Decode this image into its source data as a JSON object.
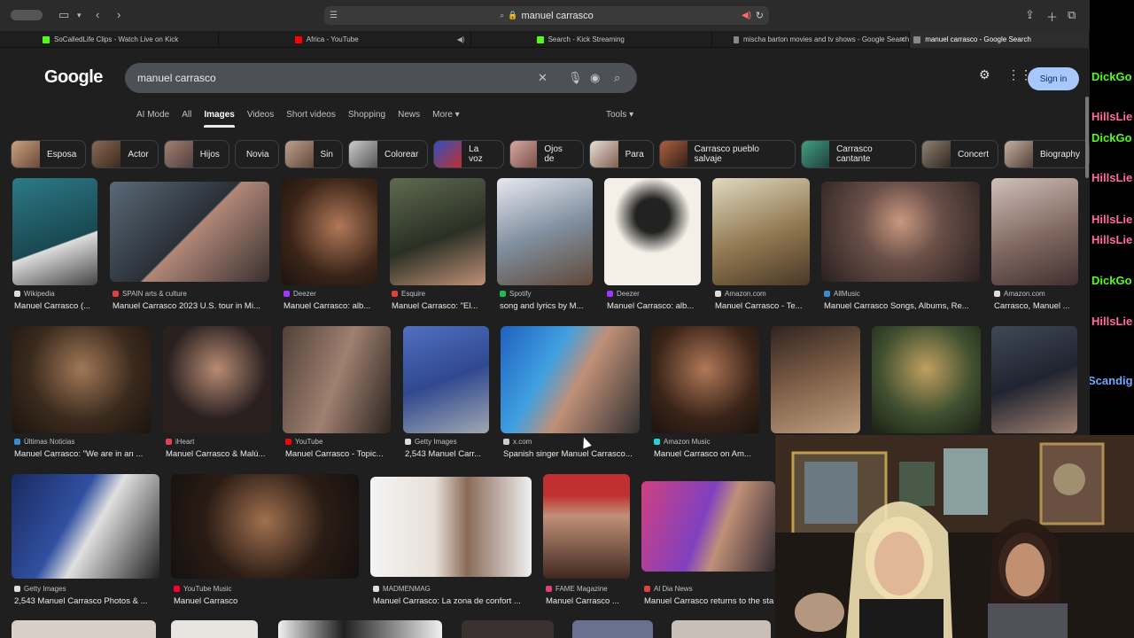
{
  "address": "manuel carrasco",
  "tabs": [
    {
      "title": "SoCalledLife Clips - Watch Live on Kick",
      "color": "#53fc18",
      "active": false
    },
    {
      "title": "Africa - YouTube",
      "color": "#ff0000",
      "active": false
    },
    {
      "title": "Search - Kick Streaming",
      "color": "#53fc18",
      "active": false
    },
    {
      "title": "mischa barton movies and tv shows - Google Search",
      "color": "#888888",
      "active": false
    },
    {
      "title": "manuel carrasco - Google Search",
      "color": "#888888",
      "active": true
    }
  ],
  "google": {
    "logo": "Google",
    "query": "manuel carrasco",
    "sign_in": "Sign in",
    "nav": [
      "AI Mode",
      "All",
      "Images",
      "Videos",
      "Short videos",
      "Shopping",
      "News",
      "More ▾"
    ],
    "tools": "Tools ▾",
    "chips": [
      "Esposa",
      "Actor",
      "Hijos",
      "Novia",
      "Sin",
      "Colorear",
      "La voz",
      "Ojos de",
      "Para",
      "Carrasco pueblo salvaje",
      "Carrasco cantante",
      "Concert",
      "Biography"
    ]
  },
  "results": {
    "row1": [
      {
        "source": "Wikipedia",
        "caption": "Manuel Carrasco (..."
      },
      {
        "source": "SPAIN arts & culture",
        "caption": "Manuel Carrasco 2023 U.S. tour in Mi..."
      },
      {
        "source": "Deezer",
        "caption": "Manuel Carrasco: alb..."
      },
      {
        "source": "Esquire",
        "caption": "Manuel Carrasco: \"El..."
      },
      {
        "source": "Spotify",
        "caption": "song and lyrics by M..."
      },
      {
        "source": "Deezer",
        "caption": "Manuel Carrasco: alb..."
      },
      {
        "source": "Amazon.com",
        "caption": "Manuel Carrasco - Te..."
      },
      {
        "source": "AllMusic",
        "caption": "Manuel Carrasco Songs, Albums, Re..."
      },
      {
        "source": "Amazon.com",
        "caption": "Carrasco, Manuel ..."
      }
    ],
    "row2": [
      {
        "source": "Últimas Noticias",
        "caption": "Manuel Carrasco: \"We are in an ..."
      },
      {
        "source": "iHeart",
        "caption": "Manuel Carrasco & Malú..."
      },
      {
        "source": "YouTube",
        "caption": "Manuel Carrasco - Topic..."
      },
      {
        "source": "Getty Images",
        "caption": "2,543 Manuel Carr..."
      },
      {
        "source": "x.com",
        "caption": "Spanish singer Manuel Carrasco..."
      },
      {
        "source": "Amazon Music",
        "caption": "Manuel Carrasco on Am..."
      }
    ],
    "row3": [
      {
        "source": "Getty Images",
        "caption": "2,543 Manuel Carrasco Photos & ..."
      },
      {
        "source": "YouTube Music",
        "caption": "Manuel Carrasco"
      },
      {
        "source": "MADMENMAG",
        "caption": "Manuel Carrasco: La zona de confort ..."
      },
      {
        "source": "FAME Magazine",
        "caption": "Manuel Carrasco ..."
      },
      {
        "source": "Al Dia News",
        "caption": "Manuel Carrasco returns to the sta"
      }
    ]
  },
  "overlay": [
    "DickGo",
    "HillsLie",
    "DickGo",
    "HillsLie",
    "HillsLie",
    "HillsLie",
    "DickGo",
    "HillsLie",
    "Scandig"
  ]
}
